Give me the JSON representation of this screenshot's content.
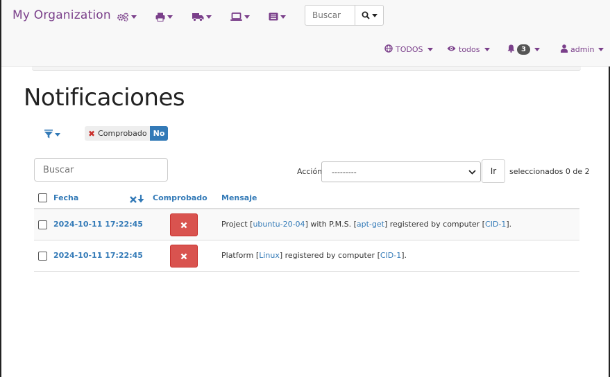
{
  "navbar": {
    "brand": "My Organization",
    "icons": [
      "cogs-icon",
      "print-icon",
      "truck-icon",
      "laptop-icon",
      "list-icon"
    ],
    "search_placeholder": "Buscar",
    "project_filter": "TODOS",
    "view_filter": "todos",
    "notifications_count": "3",
    "user": "admin"
  },
  "main": {
    "title": "Notificaciones",
    "active_filter": {
      "label": "Comprobado",
      "value": "No"
    },
    "search_placeholder": "Buscar",
    "action_label": "Acción:",
    "action_selected": "---------",
    "go_label": "Ir",
    "selection_count": "seleccionados 0 de 2"
  },
  "table": {
    "headers": {
      "date": "Fecha",
      "checked": "Comprobado",
      "message": "Mensaje"
    },
    "rows": [
      {
        "date": "2024-10-11 17:22:45",
        "checked": false,
        "msg": [
          {
            "t": "Project ["
          },
          {
            "t": "ubuntu-20-04",
            "link": true
          },
          {
            "t": "] with P.M.S. ["
          },
          {
            "t": "apt-get",
            "link": true
          },
          {
            "t": "] registered by computer ["
          },
          {
            "t": "CID-1",
            "link": true
          },
          {
            "t": "]."
          }
        ]
      },
      {
        "date": "2024-10-11 17:22:45",
        "checked": false,
        "msg": [
          {
            "t": "Platform ["
          },
          {
            "t": "Linux",
            "link": true
          },
          {
            "t": "] registered by computer ["
          },
          {
            "t": "CID-1",
            "link": true
          },
          {
            "t": "]."
          }
        ]
      }
    ]
  },
  "colors": {
    "brand": "#7a3f8a",
    "link": "#337ab7",
    "danger": "#d9534f",
    "badge": "#555555"
  }
}
